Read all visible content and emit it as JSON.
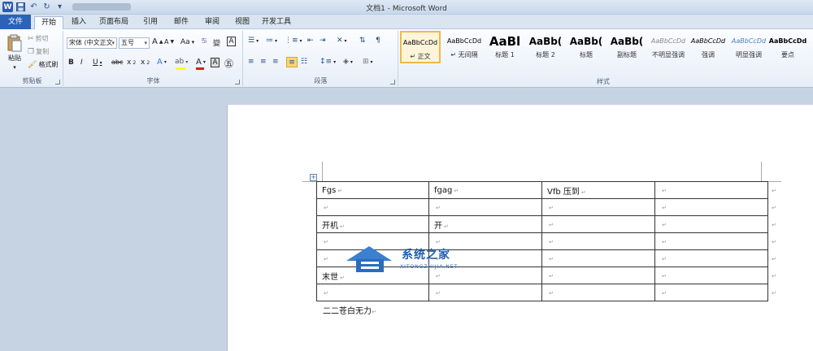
{
  "window": {
    "title": "文档1 - Microsoft Word"
  },
  "tabs": [
    {
      "label": "文件"
    },
    {
      "label": "开始"
    },
    {
      "label": "插入"
    },
    {
      "label": "页面布局"
    },
    {
      "label": "引用"
    },
    {
      "label": "邮件"
    },
    {
      "label": "审阅"
    },
    {
      "label": "视图"
    },
    {
      "label": "开发工具"
    }
  ],
  "clipboard": {
    "paste": "粘贴",
    "cut": "剪切",
    "copy": "复制",
    "format_painter": "格式刷",
    "label": "剪贴板"
  },
  "font": {
    "family": "宋体 (中文正文",
    "size": "五号",
    "label": "字体",
    "change_case": "Aa",
    "grow": "A",
    "shrink": "A"
  },
  "paragraph": {
    "label": "段落"
  },
  "styles": {
    "label": "样式",
    "items": [
      {
        "preview": "AaBbCcDd",
        "name": "↵ 正文"
      },
      {
        "preview": "AaBbCcDd",
        "name": "↵ 无间隔"
      },
      {
        "preview": "AaBl",
        "name": "标题 1"
      },
      {
        "preview": "AaBb(",
        "name": "标题 2"
      },
      {
        "preview": "AaBb(",
        "name": "标题"
      },
      {
        "preview": "AaBb(",
        "name": "副标题"
      },
      {
        "preview": "AaBbCcDd",
        "name": "不明显强调"
      },
      {
        "preview": "AaBbCcDd",
        "name": "强调"
      },
      {
        "preview": "AaBbCcDd",
        "name": "明显强调"
      },
      {
        "preview": "AaBbCcDd",
        "name": "要点"
      }
    ]
  },
  "document": {
    "mark": "↵",
    "table": [
      [
        "Fgs",
        "fgag",
        "Vfb 压到",
        ""
      ],
      [
        "",
        "",
        "",
        ""
      ],
      [
        "开机",
        "开",
        "",
        ""
      ],
      [
        "",
        "",
        "",
        ""
      ],
      [
        "",
        "",
        "",
        ""
      ],
      [
        "末世",
        "",
        "",
        ""
      ],
      [
        "",
        "",
        "",
        ""
      ]
    ],
    "after_table": "二二苍白无力"
  },
  "watermark": {
    "title": "系统之家",
    "url": "XITONGZHIJIA.NET"
  },
  "colors": {
    "file_tab": "#2a63b8",
    "style_highlight": "#f0b84a",
    "font_color_bar": "#e0191b",
    "highlight_bar": "#ffff00"
  }
}
